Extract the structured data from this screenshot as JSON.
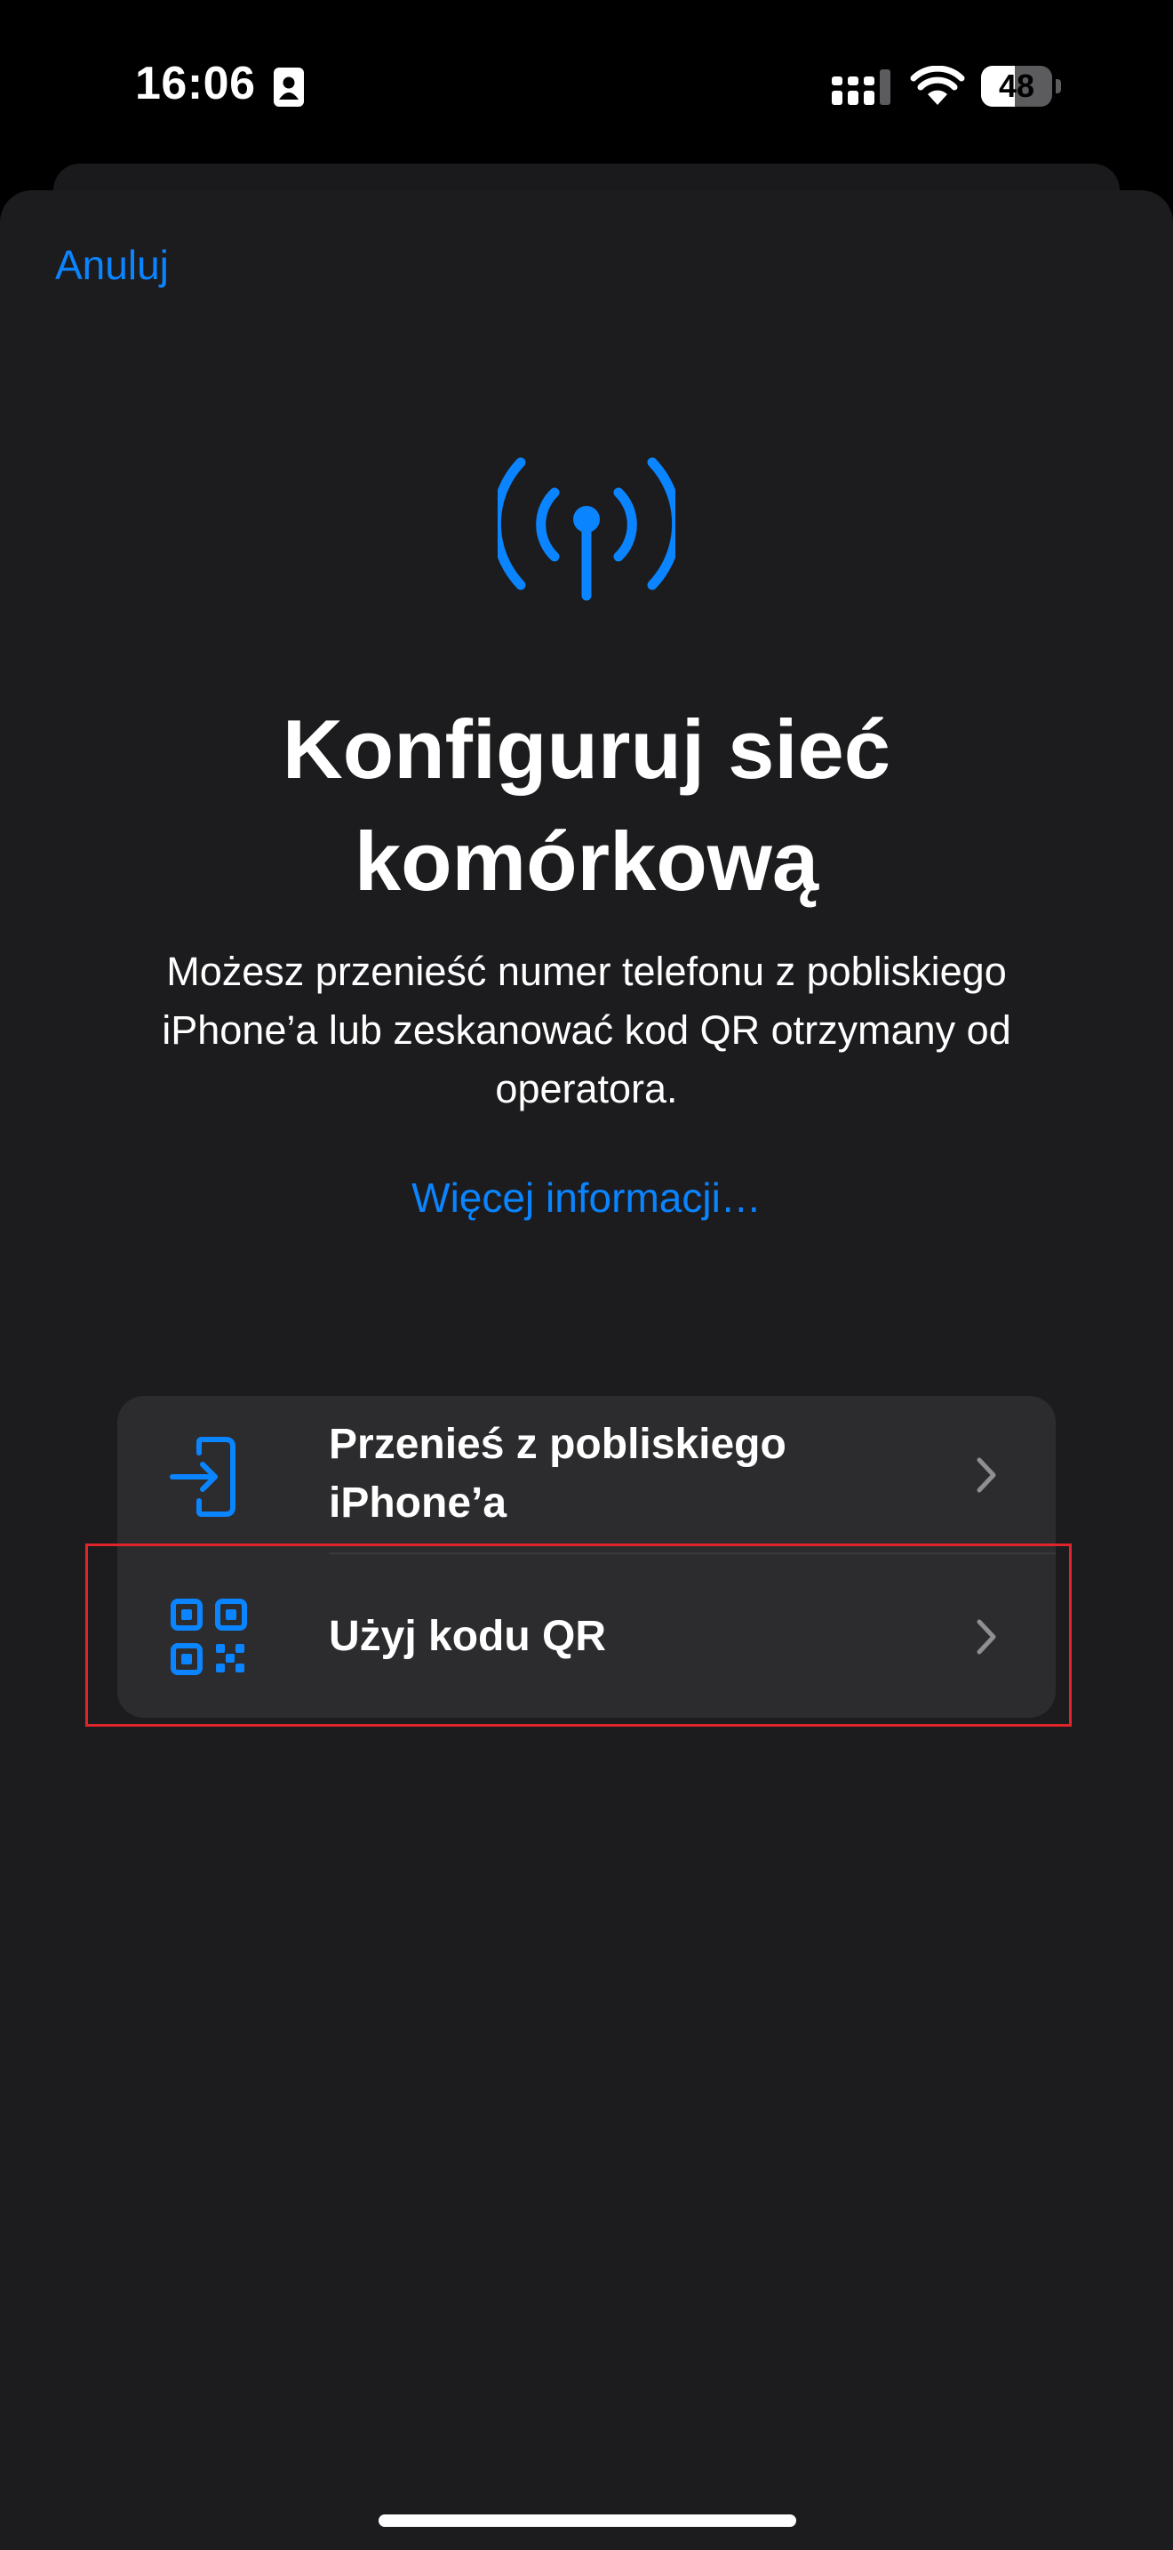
{
  "status_bar": {
    "time": "16:06",
    "battery_percent": "48",
    "battery_level": 0.48
  },
  "sheet": {
    "cancel_label": "Anuluj",
    "title": "Konfiguruj sieć komórkową",
    "description": "Możesz przenieść numer telefonu z pobliskiego iPhone’a lub zeskanować kod QR otrzymany od operatora.",
    "more_info_label": "Więcej informacji…",
    "options": [
      {
        "label": "Przenieś z pobliskiego iPhone’a",
        "icon": "transfer-in-icon"
      },
      {
        "label": "Użyj kodu QR",
        "icon": "qr-code-icon"
      }
    ]
  },
  "colors": {
    "accent": "#0a84ff",
    "sheet_background": "#1c1c1e",
    "row_background": "#2c2c2e",
    "highlight": "#e0242b"
  }
}
